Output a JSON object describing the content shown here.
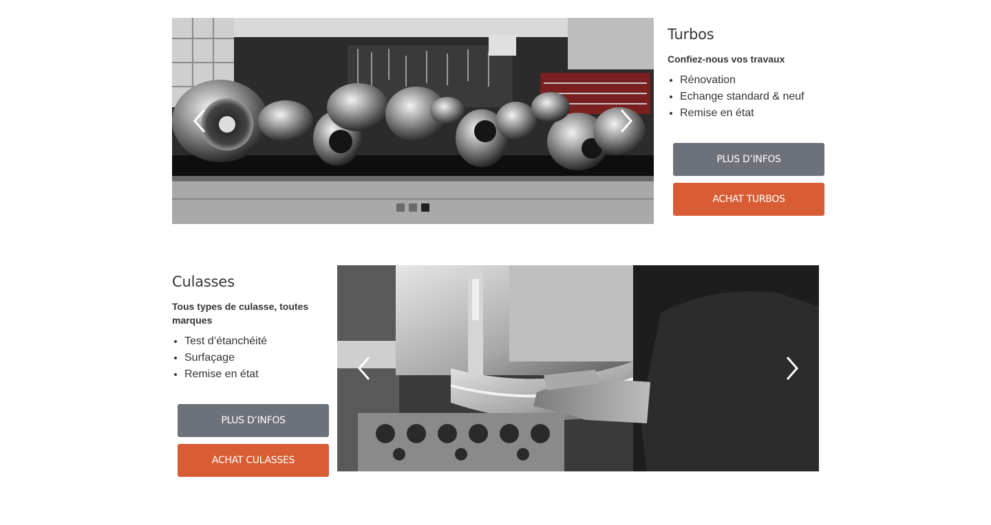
{
  "colors": {
    "button_info": "#6d717a",
    "button_buy": "#d95d34",
    "text": "#333333",
    "dot_inactive": "#6a6a6a",
    "dot_active": "#1e1e1e"
  },
  "turbos": {
    "title": "Turbos",
    "subtitle": "Confiez-nous vos travaux",
    "features": [
      "Rénovation",
      "Echange standard & neuf",
      "Remise en état"
    ],
    "info_button": "PLUS D’INFOS",
    "buy_button": "ACHAT TURBOS",
    "slider": {
      "image": "turbochargers-on-workbench-photo",
      "prev_icon": "chevron-left-icon",
      "next_icon": "chevron-right-icon",
      "slide_count": 3,
      "active_slide": 3
    }
  },
  "culasses": {
    "title": "Culasses",
    "subtitle": "Tous types de culasse, toutes marques",
    "features": [
      "Test d’étanchéité",
      "Surfaçage",
      "Remise en état"
    ],
    "info_button": "PLUS D’INFOS",
    "buy_button": "ACHAT CULASSES",
    "slider": {
      "image": "mechanic-handling-cylinder-head-machine-photo",
      "prev_icon": "chevron-left-icon",
      "next_icon": "chevron-right-icon"
    }
  }
}
